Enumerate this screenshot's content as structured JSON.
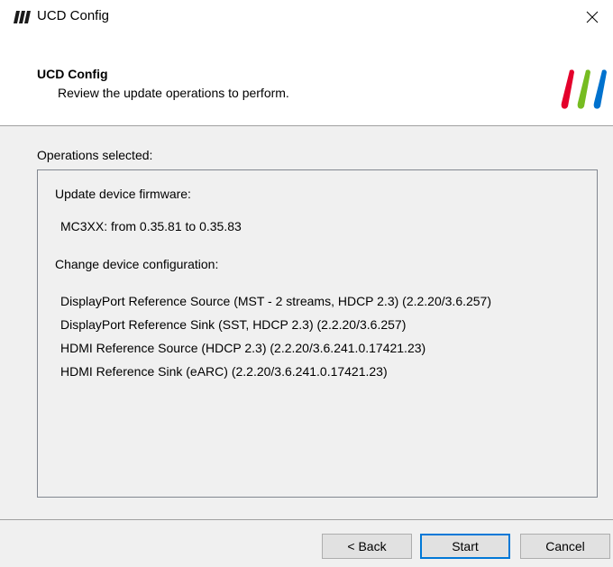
{
  "window": {
    "title": "UCD Config",
    "close_icon": "close-icon"
  },
  "header": {
    "title": "UCD Config",
    "subtitle": "Review the update operations to perform.",
    "logo_colors": [
      "#e4002b",
      "#76bc21",
      "#0072ce"
    ]
  },
  "operations": {
    "label": "Operations selected:",
    "firmware_heading": "Update device firmware:",
    "firmware_items": [
      "MC3XX: from 0.35.81 to 0.35.83"
    ],
    "config_heading": "Change device configuration:",
    "config_items": [
      "DisplayPort Reference Source (MST - 2 streams, HDCP 2.3) (2.2.20/3.6.257)",
      "DisplayPort Reference Sink (SST, HDCP 2.3) (2.2.20/3.6.257)",
      "HDMI Reference Source (HDCP 2.3) (2.2.20/3.6.241.0.17421.23)",
      "HDMI Reference Sink (eARC) (2.2.20/3.6.241.0.17421.23)"
    ]
  },
  "buttons": {
    "back": "< Back",
    "start": "Start",
    "cancel": "Cancel"
  },
  "colors": {
    "accent": "#0078d7",
    "button_face": "#e1e1e1"
  }
}
